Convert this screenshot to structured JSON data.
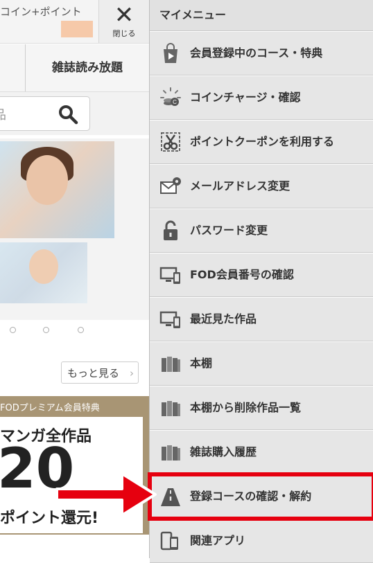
{
  "header": {
    "coin_label": "コイン+ポイント",
    "close_label": "閉じる"
  },
  "tabs": {
    "magazine": "雑誌読み放題"
  },
  "search": {
    "placeholder_fragment": "品"
  },
  "more_button": "もっと見る",
  "promo": {
    "heading": "FODプレミアム会員特典",
    "line1": "マンガ全作品",
    "big": "20",
    "line2": "ポイント還元!"
  },
  "menu": {
    "title": "マイメニュー",
    "items": [
      {
        "label": "会員登録中のコース・特典",
        "icon": "shopping-bag-icon"
      },
      {
        "label": "コインチャージ・確認",
        "icon": "coin-charge-icon"
      },
      {
        "label": "ポイントクーポンを利用する",
        "icon": "coupon-scissors-icon"
      },
      {
        "label": "メールアドレス変更",
        "icon": "mail-gear-icon"
      },
      {
        "label": "パスワード変更",
        "icon": "padlock-icon"
      },
      {
        "label": "FOD会員番号の確認",
        "icon": "devices-icon"
      },
      {
        "label": "最近見た作品",
        "icon": "devices-icon"
      },
      {
        "label": "本棚",
        "icon": "bookshelf-icon"
      },
      {
        "label": "本棚から削除作品一覧",
        "icon": "bookshelf-icon"
      },
      {
        "label": "雑誌購入履歴",
        "icon": "bookshelf-icon"
      },
      {
        "label": "登録コースの確認・解約",
        "icon": "road-icon"
      },
      {
        "label": "関連アプリ",
        "icon": "phone-icon"
      }
    ]
  },
  "colors": {
    "highlight": "#e6000f",
    "promo_bg": "#a89574"
  }
}
